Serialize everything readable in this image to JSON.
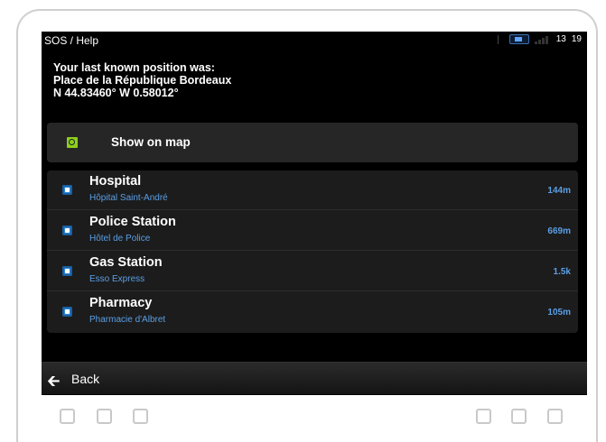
{
  "statusbar": {
    "title": "SOS / Help",
    "clock_hours": "13",
    "clock_minutes": "19"
  },
  "position": {
    "line1": "Your last known position was:",
    "line2": "Place de la République  Bordeaux",
    "line3": "N 44.83460° W 0.58012°"
  },
  "show_on_map": {
    "label": "Show on map",
    "icon": "magnifier-map-icon"
  },
  "poi_list": [
    {
      "name": "Hospital",
      "sub": "Hôpital Saint-André",
      "dist": "144m",
      "icon": "hospital-icon"
    },
    {
      "name": "Police Station",
      "sub": "Hôtel de Police",
      "dist": "669m",
      "icon": "police-icon"
    },
    {
      "name": "Gas Station",
      "sub": "Esso Express",
      "dist": "1.5k",
      "icon": "fuel-icon"
    },
    {
      "name": "Pharmacy",
      "sub": "Pharmacie d'Albret",
      "dist": "105m",
      "icon": "pharmacy-icon"
    }
  ],
  "back": {
    "label": "Back",
    "icon": "left-arrow-icon"
  },
  "colors": {
    "screen_bg": "#000000",
    "accent_blue": "#5a9fe6",
    "map_icon_green": "#8fcf1a"
  }
}
